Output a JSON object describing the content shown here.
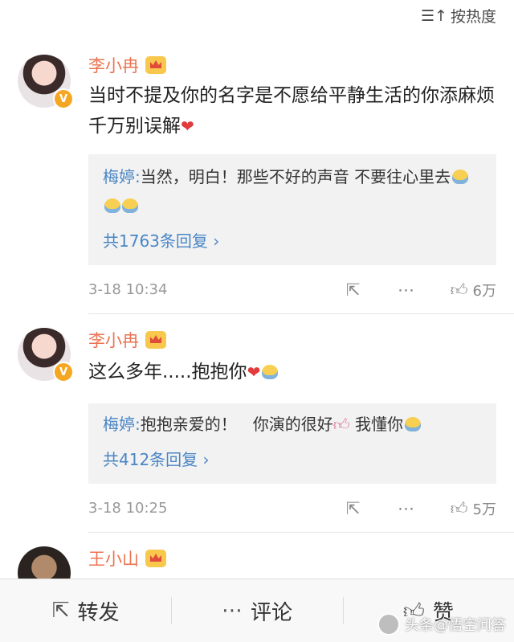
{
  "sort": {
    "label": "按热度"
  },
  "comments": [
    {
      "name": "李小冉",
      "text": "当时不提及你的名字是不愿给平静生活的你添麻烦 千万别误解",
      "reply": {
        "name": "梅婷:",
        "text": "当然，明白！那些不好的声音 不要往心里去"
      },
      "more": "共1763条回复 ›",
      "time": "3-18 10:34",
      "likes": "6万"
    },
    {
      "name": "李小冉",
      "text": "这么多年.....抱抱你",
      "reply": {
        "name": "梅婷:",
        "text": "抱抱亲爱的！　你演的很好",
        "text2": "我懂你"
      },
      "more": "共412条回复 ›",
      "time": "3-18 10:25",
      "likes": "5万"
    },
    {
      "name": "王小山"
    }
  ],
  "bottom_bar": {
    "repost": "转发",
    "comment": "评论",
    "like": "赞"
  },
  "watermark": "头条@悟空问答",
  "colors": {
    "name": "#eb7350",
    "link": "#4a86c5",
    "heart": "#e23b3b",
    "meta": "#999999"
  }
}
